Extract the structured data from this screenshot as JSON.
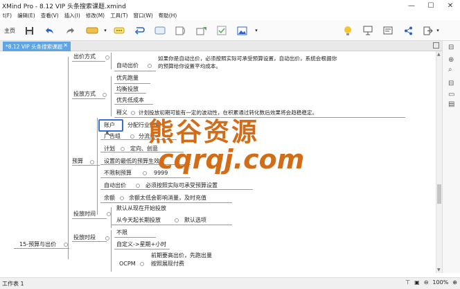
{
  "window": {
    "title": "XMind Pro - 8.12 VIP 头条搜索课题.xmind"
  },
  "menu": [
    "t(F)",
    "编辑(E)",
    "查看(V)",
    "插入(I)",
    "修改(M)",
    "工具(T)",
    "窗口(W)",
    "帮助(H)"
  ],
  "toolbar": {
    "home": "主页"
  },
  "tab": {
    "label": "*8.12 VIP 头条搜索课题"
  },
  "mindmap": {
    "chujia_fangshi": "出价方式",
    "zidong_chujia": "自动出价",
    "zidong_desc_1": "如果你是自动出价，必须按照实际可承受预算设置，自动出价，系统会根据你",
    "zidong_desc_2": "的预算给你设置平均成本。",
    "toufang_fangshi": "投放方式",
    "youxian_paoliang": "优先跑量",
    "junheng": "均衡投放",
    "youxian_dichengben": "优先低成本",
    "shiyi": "释义",
    "shiyi_desc": "计划投放初期可能有一定的波动性，在积累通过转化数后效果将会趋稳稳定。",
    "zhanghu": "账户",
    "zhanghu_desc": "分配行业流量",
    "guanggao_zu": "广告组",
    "guanggao_zu_desc": "分流量",
    "jihua": "计划",
    "jihua_desc": "定向、创意",
    "yusuan": "预算",
    "zuidi_yusuan": "设置的最低的预算生效",
    "buxianzhi": "不限制预算",
    "buxianzhi_val": "9999",
    "yusuan_zidong": "自动出价",
    "yusuan_zidong_desc": "必须按照实际可承受预算设置",
    "yue": "余额",
    "yue_desc": "余额太低会影响消量，及时充值",
    "toufang_shijian": "投放时间",
    "moren_kaishi": "默认从现在开始投放",
    "cong_jintian": "从今天起长期投放",
    "moren_xuanxiang": "默认选项",
    "toufang_shiduan": "投放时段",
    "buxian": "不限",
    "zidingyi": "自定义->星期+小时",
    "root": "15-预算与出价",
    "ocpm": "OCPM",
    "ocpm_desc_1": "前期要高出价，先跑出量",
    "ocpm_desc_2": "按照展现付费"
  },
  "watermark": {
    "line1": "熊谷资源",
    "line2": "cqrqj.com"
  },
  "status": {
    "sheet": "工作表 1",
    "zoom": "100%"
  }
}
